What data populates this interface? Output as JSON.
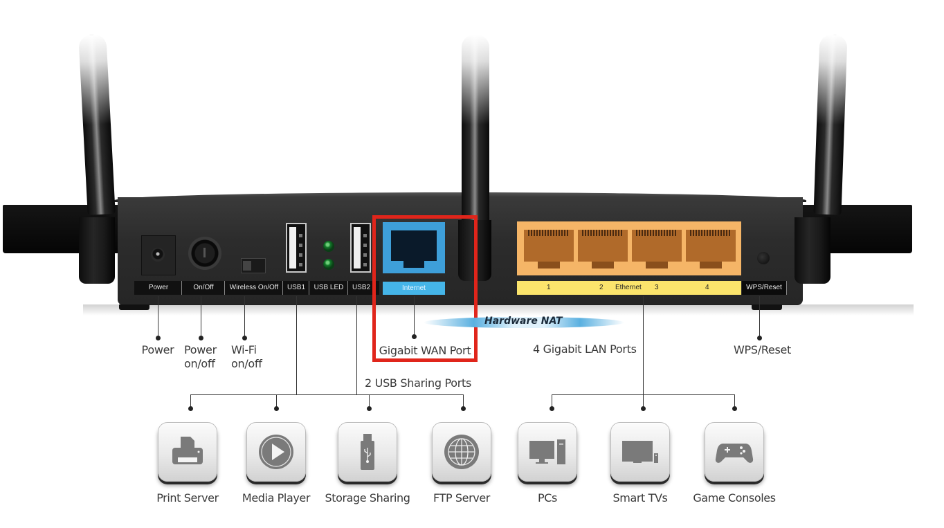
{
  "router": {
    "port_labels": [
      "Power",
      "On/Off",
      "Wireless On/Off",
      "USB1",
      "USB LED",
      "USB2"
    ],
    "wan_label": "Internet",
    "lan_numbers": [
      "1",
      "2",
      "3",
      "4"
    ],
    "lan_label": "Ethernet",
    "wps_label": "WPS/Reset",
    "colors": {
      "wan": "#45b5e8",
      "lan": "#f5b567",
      "lan_strip": "#fbe46c",
      "highlight": "#e0251b"
    }
  },
  "callouts": {
    "power": "Power",
    "power_onoff_line1": "Power",
    "power_onoff_line2": "on/off",
    "wifi_onoff_line1": "Wi-Fi",
    "wifi_onoff_line2": "on/off",
    "wan": "Gigabit WAN Port",
    "hardware_nat": "Hardware NAT",
    "lan": "4 Gigabit LAN Ports",
    "wps": "WPS/Reset",
    "usb": "2 USB Sharing Ports"
  },
  "features": [
    {
      "label": "Print Server",
      "icon": "printer-icon"
    },
    {
      "label": "Media Player",
      "icon": "play-icon"
    },
    {
      "label": "Storage Sharing",
      "icon": "usb-drive-icon"
    },
    {
      "label": "FTP Server",
      "icon": "globe-icon"
    },
    {
      "label": "PCs",
      "icon": "desktop-pc-icon"
    },
    {
      "label": "Smart TVs",
      "icon": "tv-icon"
    },
    {
      "label": "Game Consoles",
      "icon": "gamepad-icon"
    }
  ]
}
